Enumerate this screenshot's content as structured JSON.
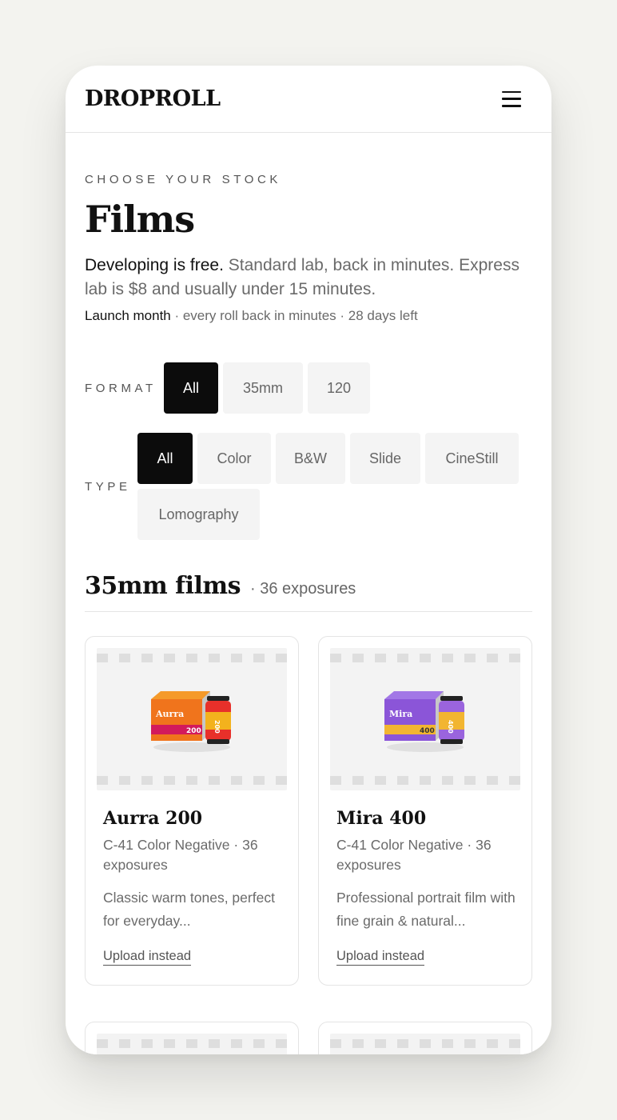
{
  "brand": {
    "logo": "DROPROLL"
  },
  "header": {
    "menu_icon": "menu-icon"
  },
  "hero": {
    "eyebrow": "CHOOSE YOUR STOCK",
    "title": "Films",
    "intro_bold": "Developing is free.",
    "intro_rest": " Standard lab, back in minutes. Express lab is $8 and usually under 15 minutes.",
    "promo_bold": "Launch month",
    "promo_rest": " · every roll back in minutes · 28 days left"
  },
  "filters": {
    "format": {
      "label": "FORMAT",
      "options": [
        "All",
        "35mm",
        "120"
      ],
      "selected": "All"
    },
    "type": {
      "label": "TYPE",
      "options": [
        "All",
        "Color",
        "B&W",
        "Slide",
        "CineStill",
        "Lomography"
      ],
      "selected": "All"
    }
  },
  "section": {
    "title": "35mm films",
    "subtitle": "· 36 exposures"
  },
  "films": [
    {
      "name": "Aurra 200",
      "meta": "C-41 Color Negative · 36 exposures",
      "description": "Classic warm tones, perfect for everyday...",
      "link": "Upload instead",
      "box_label": "Aurra",
      "speed": "200",
      "colors": {
        "box": "#f0741c",
        "box_top": "#f59a2a",
        "band": "#d21a5c",
        "can": "#e8302a",
        "can_band": "#f3b21d"
      }
    },
    {
      "name": "Mira 400",
      "meta": "C-41 Color Negative · 36 exposures",
      "description": "Professional portrait film with fine grain & natural...",
      "link": "Upload instead",
      "box_label": "Mira",
      "speed": "400",
      "colors": {
        "box": "#8b55d8",
        "box_top": "#a277e6",
        "band": "#f2b531",
        "can": "#9a64dd",
        "can_band": "#f2b531"
      }
    }
  ]
}
